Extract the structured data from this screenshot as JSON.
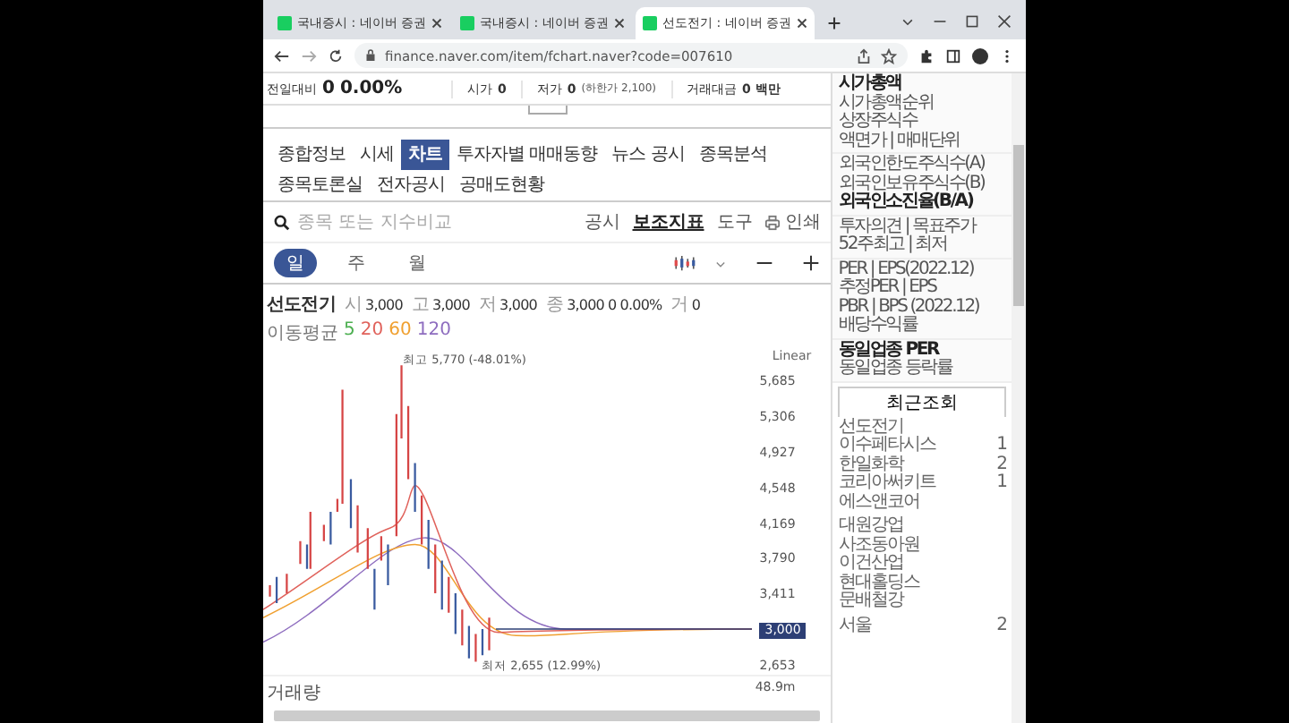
{
  "browser": {
    "tabs": [
      {
        "title": "국내증시 : 네이버 증권",
        "selected": false
      },
      {
        "title": "국내증시 : 네이버 증권",
        "selected": false
      },
      {
        "title": "선도전기 : 네이버 증권",
        "selected": true
      }
    ],
    "url": "finance.naver.com/item/fchart.naver?code=007610"
  },
  "quote_bar": {
    "change_label": "전일대비",
    "change_value": "0",
    "change_rate": "0.00%",
    "open": {
      "label": "시가",
      "value": "0"
    },
    "low": {
      "label": "저가",
      "value": "0",
      "note": "(하한가 2,100)"
    },
    "trade_value": {
      "label": "거래대금",
      "value": "0 백만"
    }
  },
  "nav_tabs": [
    {
      "label": "종합정보",
      "selected": false
    },
    {
      "label": "시세",
      "selected": false
    },
    {
      "label": "차트",
      "selected": true
    },
    {
      "label": "투자자별 매매동향",
      "selected": false
    },
    {
      "label": "뉴스 공시",
      "selected": false
    },
    {
      "label": "종목분석",
      "selected": false
    },
    {
      "label": "종목토론실",
      "selected": false
    },
    {
      "label": "전자공시",
      "selected": false
    },
    {
      "label": "공매도현황",
      "selected": false
    }
  ],
  "toolbar": {
    "search_placeholder": "종목 또는 지수비교",
    "links": [
      {
        "label": "공시",
        "selected": false
      },
      {
        "label": "보조지표",
        "selected": true
      },
      {
        "label": "도구",
        "selected": false
      }
    ],
    "print": "인쇄"
  },
  "periods": [
    {
      "label": "일",
      "selected": true
    },
    {
      "label": "주",
      "selected": false
    },
    {
      "label": "월",
      "selected": false
    }
  ],
  "info": {
    "name": "선도전기",
    "stats": [
      {
        "label": "시",
        "value": "3,000"
      },
      {
        "label": "고",
        "value": "3,000"
      },
      {
        "label": "저",
        "value": "3,000"
      },
      {
        "label": "종",
        "value": "3,000"
      }
    ],
    "change": "0 0.00%",
    "volume_label": "거",
    "volume": "0"
  },
  "moving_average": {
    "label": "이동평균",
    "periods": [
      {
        "label": "5",
        "color": "#4caf50"
      },
      {
        "label": "20",
        "color": "#e0625b"
      },
      {
        "label": "60",
        "color": "#f0a030"
      },
      {
        "label": "120",
        "color": "#8e6dbf"
      }
    ]
  },
  "chart": {
    "scale": "Linear",
    "y_labels": [
      {
        "label": "5,685",
        "kind": "tick"
      },
      {
        "label": "5,306",
        "kind": "tick"
      },
      {
        "label": "4,927",
        "kind": "tick"
      },
      {
        "label": "4,548",
        "kind": "tick"
      },
      {
        "label": "4,169",
        "kind": "tick"
      },
      {
        "label": "3,790",
        "kind": "tick"
      },
      {
        "label": "3,411",
        "kind": "tick"
      },
      {
        "label": "3,000",
        "kind": "current"
      },
      {
        "label": "2,653",
        "kind": "tick"
      }
    ],
    "high_note": "최고 5,770 (-48.01%)",
    "low_note": "최저 2,655 (12.99%)",
    "volume_title": "거래량",
    "volume_label": "48.9m"
  },
  "sidebar": {
    "groups": [
      [
        {
          "label": "시가총액",
          "emphasis": true
        },
        {
          "label": "시가총액순위",
          "emphasis": false
        },
        {
          "label": "상장주식수",
          "emphasis": false
        },
        {
          "label": "액면가 | 매매단위",
          "emphasis": false
        }
      ],
      [
        {
          "label": "외국인한도주식수(A)",
          "emphasis": false
        },
        {
          "label": "외국인보유주식수(B)",
          "emphasis": false
        },
        {
          "label": "외국인소진율(B/A)",
          "emphasis": true
        }
      ],
      [
        {
          "label": "투자의견 | 목표주가",
          "emphasis": false
        },
        {
          "label": "52주최고 | 최저",
          "emphasis": false
        }
      ],
      [
        {
          "label": "PER | EPS(2022.12)",
          "emphasis": false
        },
        {
          "label": "추정PER | EPS",
          "emphasis": false
        },
        {
          "label": "PBR | BPS (2022.12)",
          "emphasis": false
        },
        {
          "label": "배당수익률",
          "emphasis": false
        }
      ],
      [
        {
          "label": "동일업종 PER",
          "emphasis": true
        },
        {
          "label": "동일업종 등락률",
          "emphasis": false
        }
      ]
    ]
  },
  "recent": {
    "title": "최근조회",
    "groups": [
      [
        {
          "name": "선도전기"
        },
        {
          "name": "이수페타시스",
          "count": "1"
        },
        {
          "name": "한일화학",
          "count": "2"
        },
        {
          "name": "코리아써키트",
          "count": "1"
        },
        {
          "name": "에스앤코어"
        }
      ],
      [
        {
          "name": "대원강업"
        },
        {
          "name": "사조동아원"
        },
        {
          "name": "이건산업"
        },
        {
          "name": "현대홀딩스"
        },
        {
          "name": "문배철강"
        }
      ],
      [
        {
          "name": "서울",
          "count": "2"
        }
      ]
    ]
  }
}
